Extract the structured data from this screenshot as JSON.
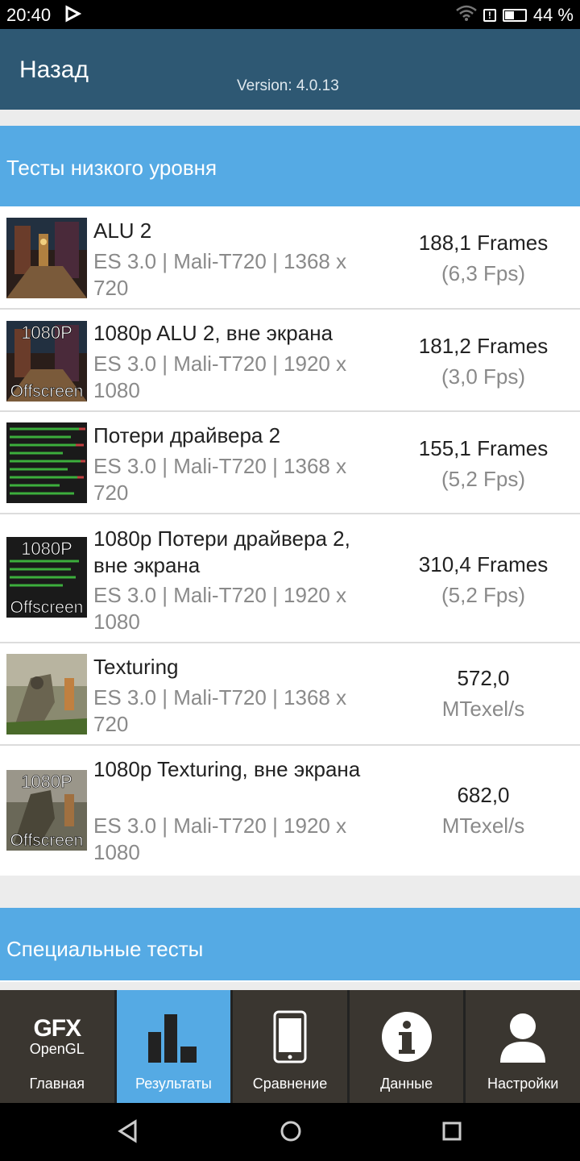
{
  "status": {
    "time": "20:40",
    "battery": "44 %",
    "battery_level": 0.44
  },
  "appbar": {
    "back": "Назад",
    "version": "Version: 4.0.13"
  },
  "section1": {
    "title": "Тесты низкого уровня"
  },
  "tests": [
    {
      "title": "ALU 2",
      "sub": "ES 3.0 | Mali-T720 | 1368 x 720",
      "value": "188,1 Frames",
      "unit": "(6,3 Fps)",
      "badge_top": "",
      "badge_bottom": ""
    },
    {
      "title": "1080p ALU 2, вне экрана",
      "sub": "ES 3.0 | Mali-T720 | 1920 x 1080",
      "value": "181,2 Frames",
      "unit": "(3,0 Fps)",
      "badge_top": "1080P",
      "badge_bottom": "Offscreen"
    },
    {
      "title": "Потери драйвера 2",
      "sub": "ES 3.0 | Mali-T720 | 1368 x 720",
      "value": "155,1 Frames",
      "unit": "(5,2 Fps)",
      "badge_top": "",
      "badge_bottom": ""
    },
    {
      "title": "1080p Потери драйвера 2, вне экрана",
      "sub": "ES 3.0 | Mali-T720 | 1920 x 1080",
      "value": "310,4 Frames",
      "unit": "(5,2 Fps)",
      "badge_top": "1080P",
      "badge_bottom": "Offscreen"
    },
    {
      "title": "Texturing",
      "sub": "ES 3.0 | Mali-T720 | 1368 x 720",
      "value": "572,0",
      "unit": "MTexel/s",
      "badge_top": "",
      "badge_bottom": ""
    },
    {
      "title": "1080p Texturing, вне экрана",
      "sub": "ES 3.0 | Mali-T720 | 1920 x 1080",
      "value": "682,0",
      "unit": "MTexel/s",
      "badge_top": "1080P",
      "badge_bottom": "Offscreen"
    }
  ],
  "section2": {
    "title": "Специальные тесты"
  },
  "tabs": [
    {
      "label": "Главная",
      "logo_line1": "GFX",
      "logo_line2": "OpenGL"
    },
    {
      "label": "Результаты"
    },
    {
      "label": "Сравнение"
    },
    {
      "label": "Данные"
    },
    {
      "label": "Настройки"
    }
  ],
  "colors": {
    "appbar": "#2e5873",
    "section": "#55aae4",
    "tab_bg": "#3a3630",
    "tab_active": "#55aae4"
  }
}
